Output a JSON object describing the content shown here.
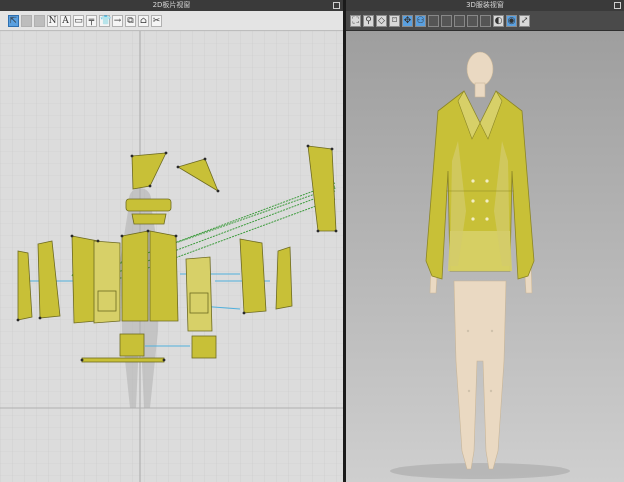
{
  "panel_2d": {
    "title": "2D板片视窗"
  },
  "panel_3d": {
    "title": "3D服装视窗"
  },
  "toolbar_2d": [
    "select-tool-icon",
    "pattern-tool-icon",
    "notch-tool-icon",
    "N",
    "A",
    "rect-tool-icon",
    "seam-tool-icon",
    "shirt-tool-icon",
    "arrow-tool-icon",
    "copy-tool-icon",
    "flip-tool-icon",
    "cut-tool-icon"
  ],
  "toolbar_3d": [
    "select-icon",
    "pin-icon",
    "fold-icon",
    "tack-icon",
    "move-icon",
    "avatar-icon",
    "fabric-icon",
    "garment-icon",
    "texture-icon",
    "wrinkle-icon",
    "stitch-icon",
    "render-icon",
    "camera-icon",
    "expand-icon"
  ],
  "colors": {
    "fabric": "#c8c037",
    "fabric_light": "#d7d068",
    "seam_green": "#3a9a3a",
    "seam_blue": "#4fb0dd"
  }
}
